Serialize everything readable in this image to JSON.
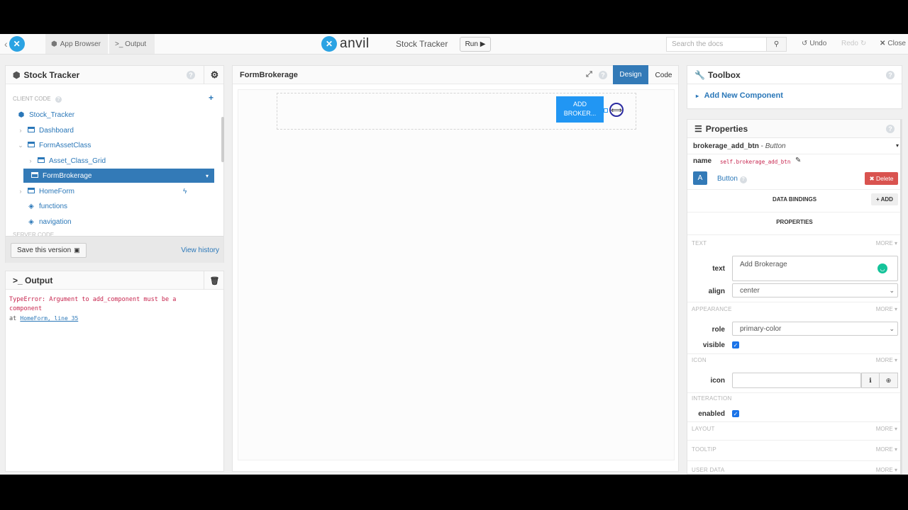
{
  "topbar": {
    "app_browser": "App Browser",
    "output": ">_ Output",
    "brand": "anvil",
    "app_title": "Stock Tracker",
    "run": "Run ▶",
    "search_placeholder": "Search the docs",
    "undo": "Undo",
    "redo": "Redo",
    "close": "Close"
  },
  "app_panel": {
    "title": "Stock Tracker",
    "client_code": "CLIENT CODE",
    "server_code": "SERVER CODE",
    "items": [
      {
        "label": "Stock_Tracker"
      },
      {
        "label": "Dashboard"
      },
      {
        "label": "FormAssetClass"
      },
      {
        "label": "Asset_Class_Grid"
      },
      {
        "label": "FormBrokerage"
      },
      {
        "label": "HomeForm"
      },
      {
        "label": "functions"
      },
      {
        "label": "navigation"
      }
    ],
    "save_version": "Save this version",
    "view_history": "View history"
  },
  "output_panel": {
    "title": ">_ Output",
    "error_line1": "TypeError: Argument to add_component must be a",
    "error_line2": "component",
    "at": "at",
    "location": "HomeForm, line 35"
  },
  "designer": {
    "form_name": "FormBrokerage",
    "design_tab": "Design",
    "code_tab": "Code",
    "button_label": "ADD BROKER..."
  },
  "toolbox": {
    "title": "Toolbox",
    "add_new": "Add New Component"
  },
  "properties": {
    "title": "Properties",
    "component": "brokerage_add_btn",
    "component_type": "Button",
    "name_label": "name",
    "name_value": "self.brokerage_add_btn",
    "type_badge": "A",
    "type_name": "Button",
    "delete": "✖ Delete",
    "data_bindings": "DATA BINDINGS",
    "add": "+ ADD",
    "properties_head": "PROPERTIES",
    "more": "MORE ▾",
    "sections": {
      "text": "TEXT",
      "appearance": "APPEARANCE",
      "icon": "ICON",
      "interaction": "INTERACTION",
      "layout": "LAYOUT",
      "tooltip": "TOOLTIP",
      "user_data": "USER DATA"
    },
    "text_label": "text",
    "text_value": "Add Brokerage",
    "align_label": "align",
    "align_value": "center",
    "role_label": "role",
    "role_value": "primary-color",
    "visible_label": "visible",
    "icon_label": "icon",
    "enabled_label": "enabled"
  },
  "colors": {
    "accent": "#337ab7",
    "button_blue": "#2196f3",
    "delete_red": "#d9534f",
    "error_text": "#c7254e"
  }
}
